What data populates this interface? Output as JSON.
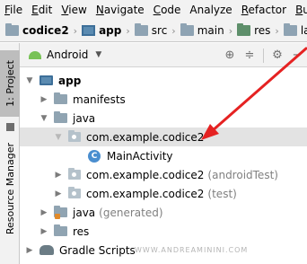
{
  "menubar": {
    "items": [
      {
        "mnemonic": "F",
        "rest": "ile"
      },
      {
        "mnemonic": "E",
        "rest": "dit"
      },
      {
        "mnemonic": "V",
        "rest": "iew"
      },
      {
        "mnemonic": "N",
        "rest": "avigate"
      },
      {
        "mnemonic": "C",
        "rest": "ode"
      },
      {
        "mnemonic": "",
        "rest": "Analyze"
      },
      {
        "mnemonic": "R",
        "rest": "efactor"
      },
      {
        "mnemonic": "B",
        "rest": "u"
      }
    ]
  },
  "breadcrumbs": {
    "items": [
      "codice2",
      "app",
      "src",
      "main",
      "res",
      "layo"
    ]
  },
  "side_tabs": {
    "project": "1: Project",
    "resource_manager": "Resource Manager"
  },
  "panel": {
    "view_mode": "Android"
  },
  "tree": {
    "rows": [
      {
        "label": "app",
        "suffix": ""
      },
      {
        "label": "manifests",
        "suffix": ""
      },
      {
        "label": "java",
        "suffix": ""
      },
      {
        "label": "com.example.codice2",
        "suffix": ""
      },
      {
        "label": "MainActivity",
        "suffix": "",
        "icon_letter": "C"
      },
      {
        "label": "com.example.codice2",
        "suffix": "(androidTest)"
      },
      {
        "label": "com.example.codice2",
        "suffix": "(test)"
      },
      {
        "label": "java",
        "suffix": "(generated)"
      },
      {
        "label": "res",
        "suffix": ""
      },
      {
        "label": "Gradle Scripts",
        "suffix": ""
      }
    ]
  },
  "watermark": "WWW.ANDREAMININI.COM",
  "colors": {
    "annotation_arrow": "#e52222",
    "selection": "#e3e3e3",
    "class_icon": "#4a8ecf"
  }
}
